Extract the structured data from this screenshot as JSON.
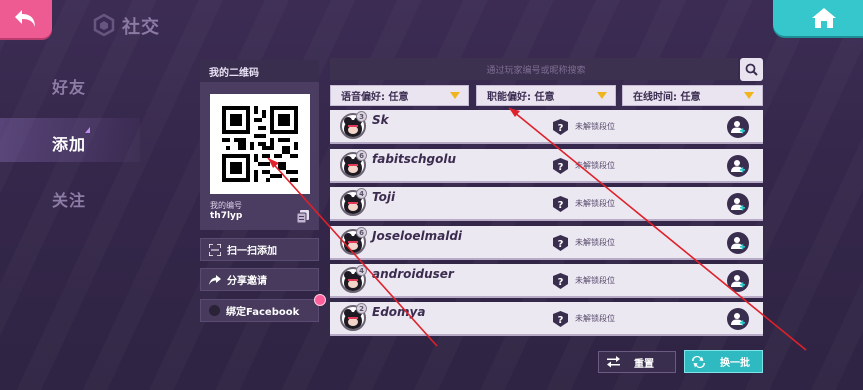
{
  "header": {
    "title": "社交",
    "back_icon": "back-arrow-icon",
    "home_icon": "home-icon"
  },
  "nav": {
    "items": [
      {
        "label": "好友",
        "active": false
      },
      {
        "label": "添加",
        "active": true
      },
      {
        "label": "关注",
        "active": false
      }
    ]
  },
  "qr_panel": {
    "title": "我的二维码",
    "id_label": "我的编号",
    "id_value": "th7lyp"
  },
  "actions": {
    "scan_label": "扫一扫添加",
    "share_label": "分享邀请",
    "facebook_label": "绑定Facebook"
  },
  "search": {
    "placeholder": "通过玩家编号或昵称搜索"
  },
  "filters": [
    {
      "label": "语音偏好: 任意"
    },
    {
      "label": "职能偏好: 任意"
    },
    {
      "label": "在线时间: 任意"
    }
  ],
  "players": [
    {
      "name": "Sk",
      "level": "3",
      "rank": "未解锁段位"
    },
    {
      "name": "fabitschgolu",
      "level": "6",
      "rank": "未解锁段位"
    },
    {
      "name": "Toji",
      "level": "4",
      "rank": "未解锁段位"
    },
    {
      "name": "Joseloelmaldi",
      "level": "6",
      "rank": "未解锁段位"
    },
    {
      "name": "androiduser",
      "level": "4",
      "rank": "未解锁段位"
    },
    {
      "name": "Edomya",
      "level": "2",
      "rank": "未解锁段位"
    }
  ],
  "buttons": {
    "reset_label": "重置",
    "refresh_label": "换一批"
  },
  "colors": {
    "background": "#3a2b50",
    "accent_pink": "#ee5b92",
    "accent_teal": "#35c7cc",
    "filter_arrow": "#f0b51c",
    "annotation_red": "#e0202a"
  }
}
